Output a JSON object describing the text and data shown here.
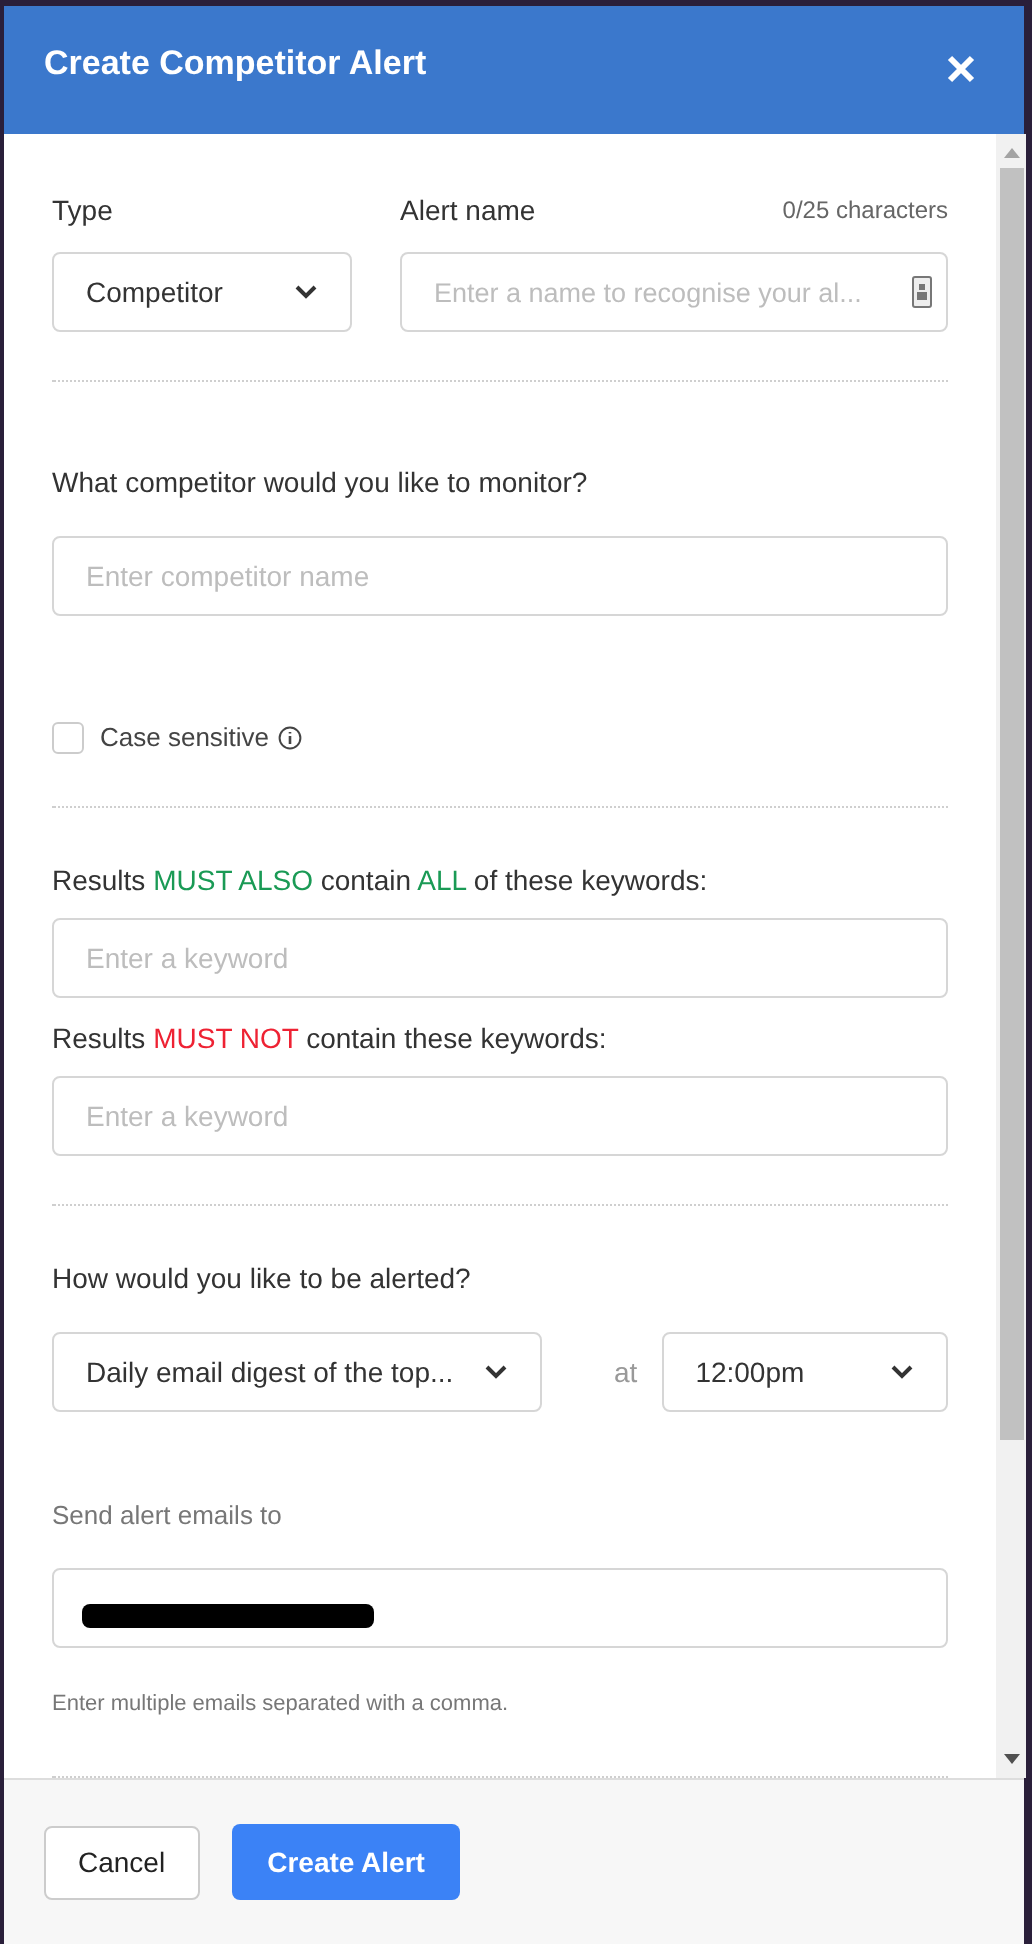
{
  "dialog": {
    "title": "Create Competitor Alert"
  },
  "type_field": {
    "label": "Type",
    "value": "Competitor"
  },
  "name_field": {
    "label": "Alert name",
    "counter": "0/25 characters",
    "placeholder": "Enter a name to recognise your al..."
  },
  "competitor_field": {
    "label": "What competitor would you like to monitor?",
    "placeholder": "Enter competitor name"
  },
  "case_sensitive": {
    "label": "Case sensitive",
    "checked": false
  },
  "keyword_fields": [
    {
      "label_parts": [
        {
          "text": "Results ",
          "kind": "plain"
        },
        {
          "text": "MUST ALSO",
          "kind": "include"
        },
        {
          "text": " contain ",
          "kind": "plain"
        },
        {
          "text": "ALL",
          "kind": "include"
        },
        {
          "text": " of these keywords:",
          "kind": "plain"
        }
      ],
      "placeholder": "Enter a keyword"
    },
    {
      "label_parts": [
        {
          "text": "Results ",
          "kind": "plain"
        },
        {
          "text": "MUST NOT",
          "kind": "exclude"
        },
        {
          "text": " contain these keywords:",
          "kind": "plain"
        }
      ],
      "placeholder": "Enter a keyword"
    }
  ],
  "alert_frequency": {
    "label": "How would you like to be alerted?",
    "value": "Daily email digest of the top...",
    "at": "at",
    "time": "12:00pm"
  },
  "email_field": {
    "label": "Send alert emails to",
    "redacted": true,
    "hint": "Enter multiple emails separated with a comma."
  },
  "buttons": {
    "cancel": "Cancel",
    "create": "Create Alert"
  }
}
